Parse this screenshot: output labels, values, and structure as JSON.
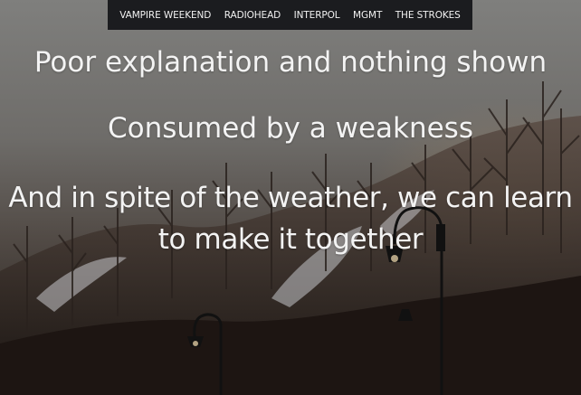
{
  "nav": {
    "items": [
      {
        "label": "VAMPIRE WEEKEND"
      },
      {
        "label": "RADIOHEAD"
      },
      {
        "label": "INTERPOL"
      },
      {
        "label": "MGMT"
      },
      {
        "label": "THE STROKES"
      }
    ]
  },
  "lyrics": {
    "line1": "Poor explanation and nothing shown",
    "line2": "Consumed by a weakness",
    "line3": "And in spite of the weather, we can learn to make it together"
  },
  "colors": {
    "navbar_bg": "#1b1c1f",
    "nav_text": "#f2f2f2",
    "lyric_text": "#f3f3f3"
  }
}
